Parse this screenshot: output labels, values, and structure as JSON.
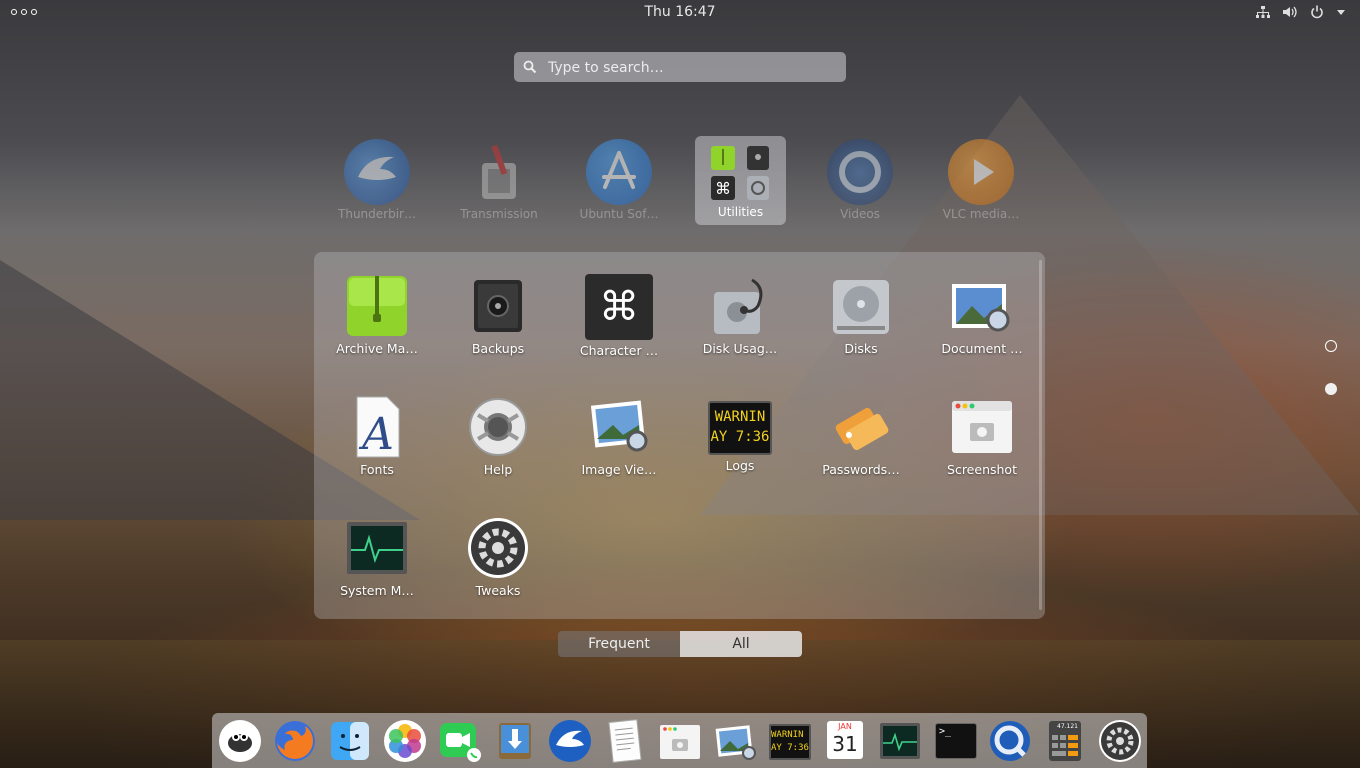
{
  "topbar": {
    "clock": "Thu 16:47",
    "activities_icon": "dots-menu-icon",
    "tray_icons": [
      "network-icon",
      "volume-icon",
      "power-icon",
      "chevron-down-icon"
    ]
  },
  "search": {
    "placeholder": "Type to search…"
  },
  "toprow": [
    {
      "label": "Thunderbir…",
      "icon": "thunderbird-icon"
    },
    {
      "label": "Transmission",
      "icon": "transmission-icon"
    },
    {
      "label": "Ubuntu Sof…",
      "icon": "ubuntu-software-icon"
    },
    {
      "label": "Utilities",
      "icon": "utilities-folder-icon"
    },
    {
      "label": "Videos",
      "icon": "videos-icon"
    },
    {
      "label": "VLC media…",
      "icon": "vlc-icon"
    }
  ],
  "folder": {
    "apps": [
      {
        "label": "Archive Ma…",
        "icon": "archive-manager-icon"
      },
      {
        "label": "Backups",
        "icon": "backups-icon"
      },
      {
        "label": "Character …",
        "icon": "characters-icon"
      },
      {
        "label": "Disk Usag…",
        "icon": "disk-usage-icon"
      },
      {
        "label": "Disks",
        "icon": "disks-icon"
      },
      {
        "label": "Document …",
        "icon": "document-viewer-icon"
      },
      {
        "label": "Fonts",
        "icon": "fonts-icon"
      },
      {
        "label": "Help",
        "icon": "help-icon"
      },
      {
        "label": "Image Vie…",
        "icon": "image-viewer-icon"
      },
      {
        "label": "Logs",
        "icon": "logs-icon"
      },
      {
        "label": "Passwords…",
        "icon": "passwords-icon"
      },
      {
        "label": "Screenshot",
        "icon": "screenshot-icon"
      },
      {
        "label": "System M…",
        "icon": "system-monitor-icon"
      },
      {
        "label": "Tweaks",
        "icon": "tweaks-icon"
      }
    ],
    "logs_text_1": "WARNIN",
    "logs_text_2": "AY 7:36",
    "calendar_month": "JAN",
    "calendar_day": "31",
    "calculator_display": "47.121",
    "char_glyph": "⌘"
  },
  "tabs": {
    "frequent": "Frequent",
    "all": "All",
    "selected": "All"
  },
  "pages": {
    "count": 2,
    "current": 2
  },
  "dock": {
    "items": [
      "gimp-icon",
      "firefox-icon",
      "finder-icon",
      "photos-icon",
      "facetime-icon",
      "installer-icon",
      "thunderbird-icon",
      "text-editor-icon",
      "screenshot-icon",
      "image-viewer-icon",
      "logs-icon",
      "calendar-icon",
      "system-monitor-icon",
      "terminal-icon",
      "quicktime-icon",
      "calculator-icon",
      "settings-icon"
    ],
    "terminal_prompt": ">_"
  },
  "colors": {
    "accent_green": "#8fd32b",
    "tab_selected_bg": "#e6e6e8"
  }
}
